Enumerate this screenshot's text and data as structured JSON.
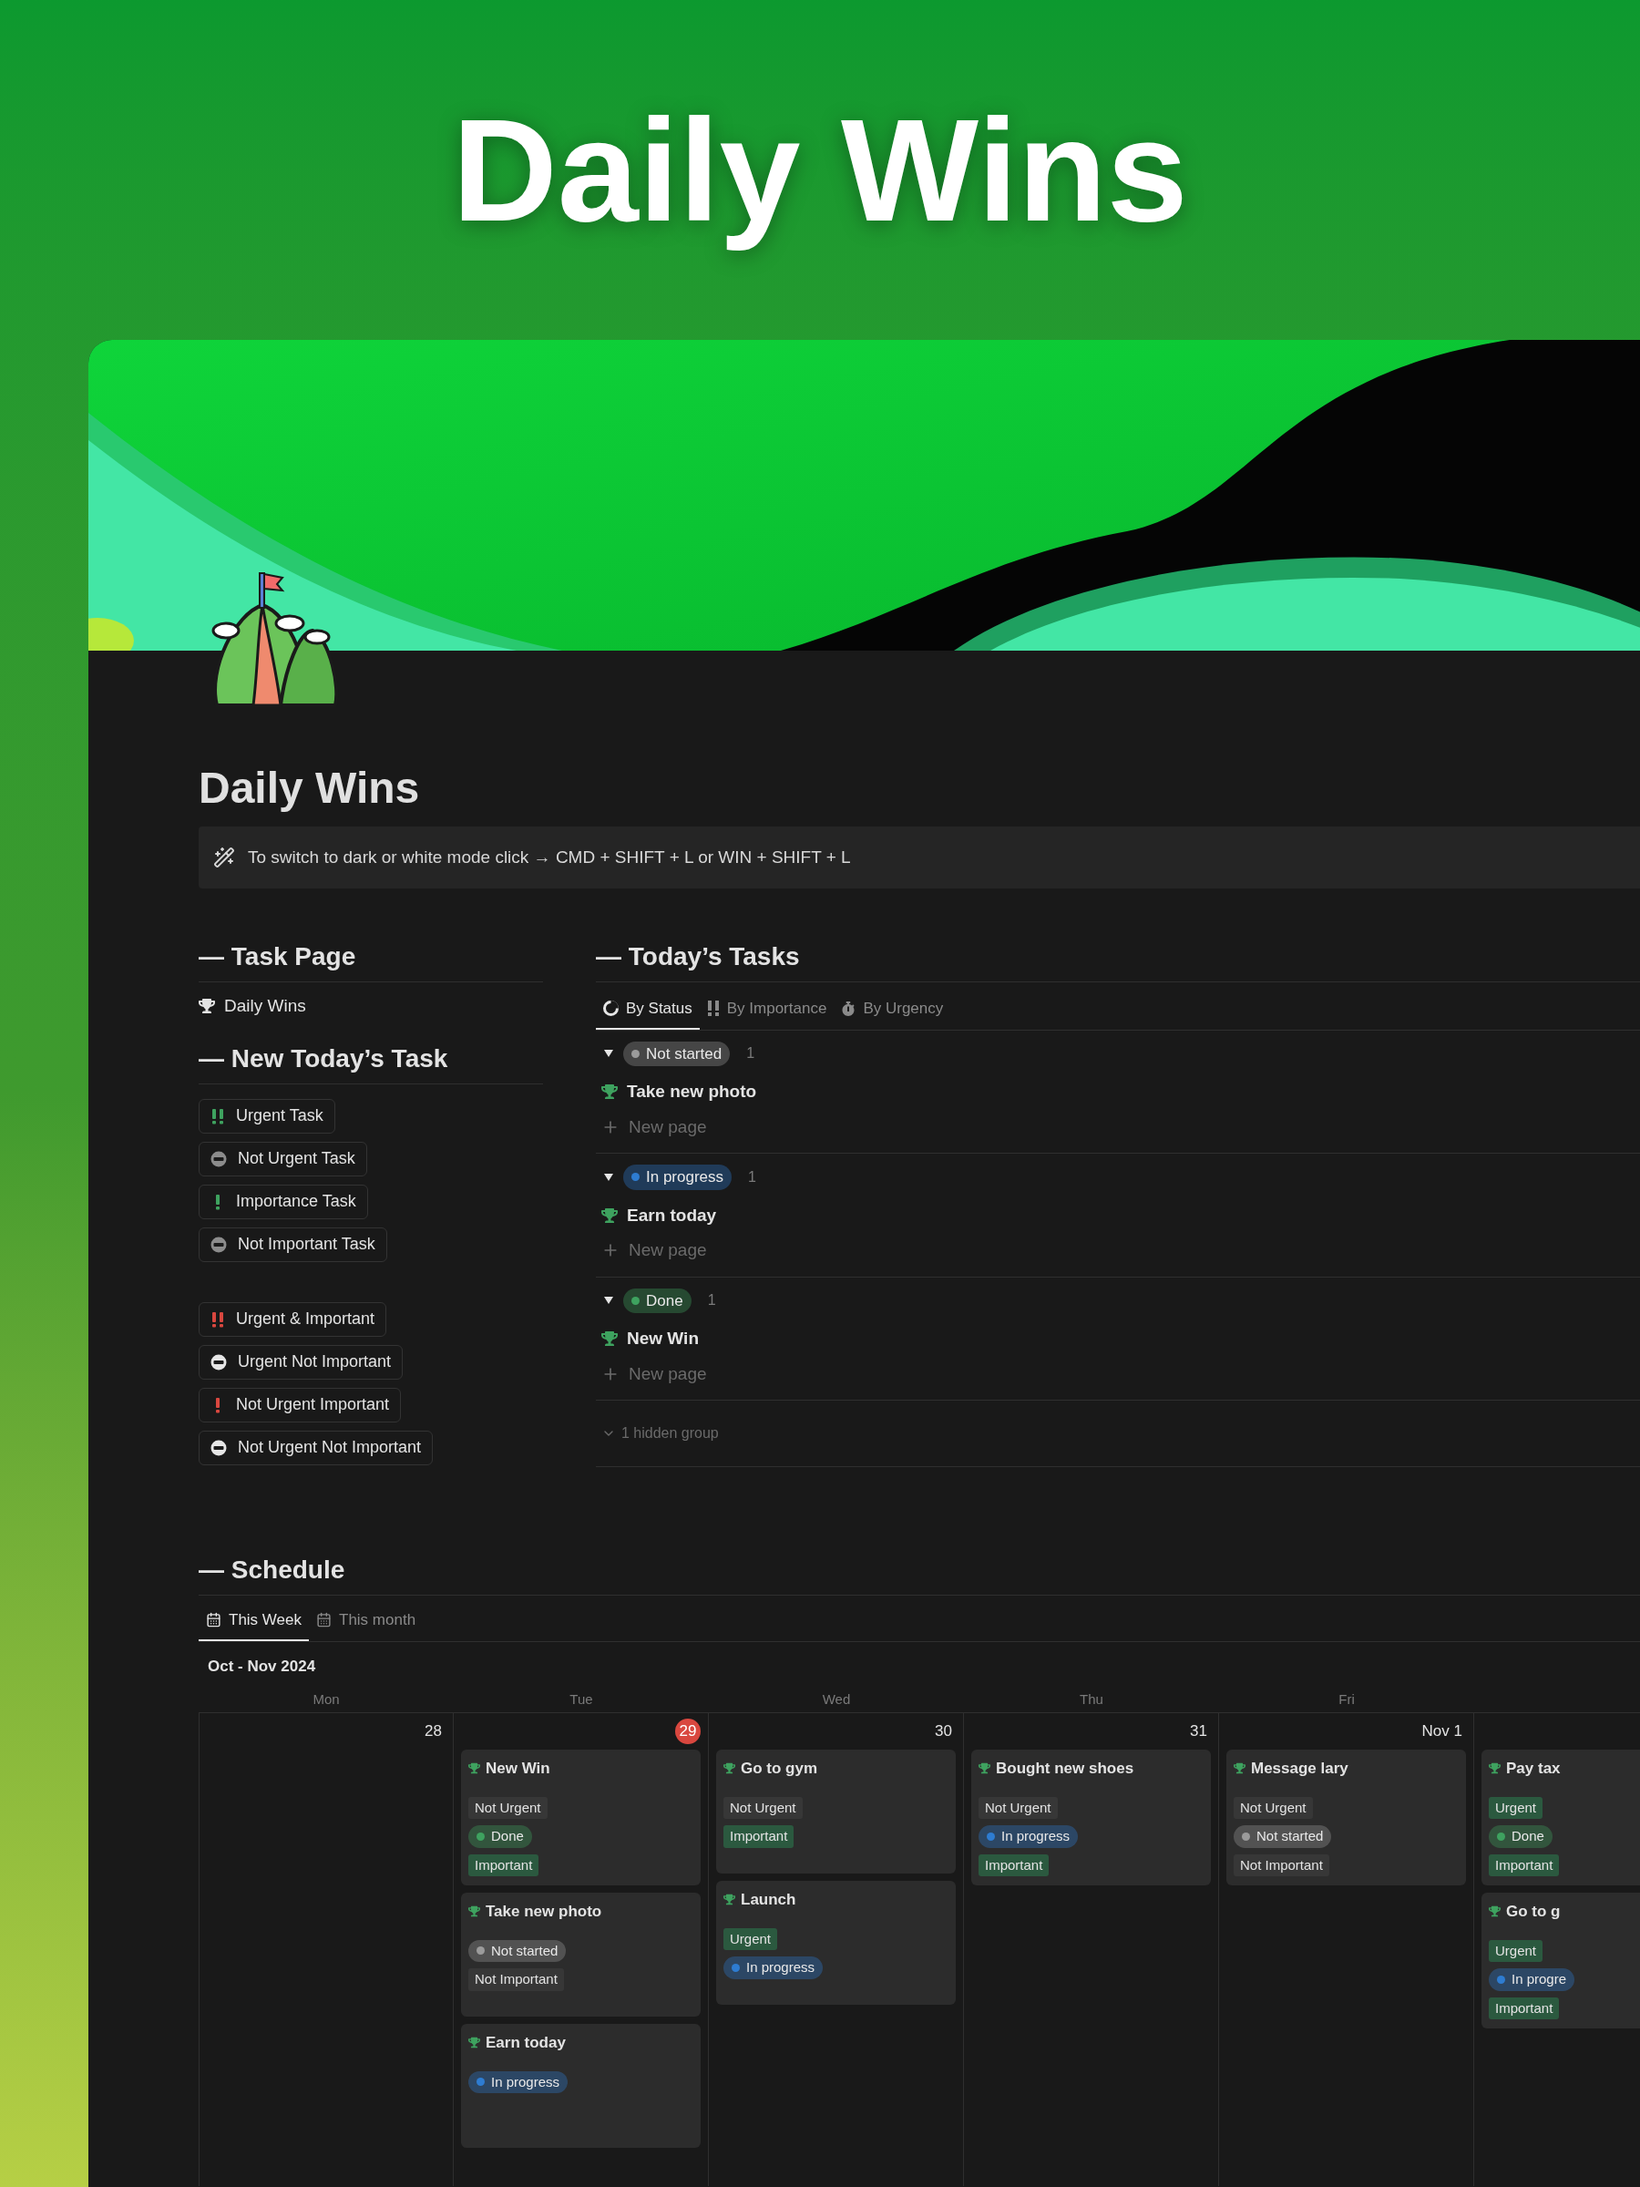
{
  "banner": {
    "title": "Daily Wins"
  },
  "page": {
    "title": "Daily Wins",
    "callout": "To switch to dark or white mode click → CMD + SHIFT + L or WIN + SHIFT + L"
  },
  "task_page": {
    "heading": "— Task Page",
    "links": [
      {
        "label": "Daily Wins"
      }
    ]
  },
  "new_task": {
    "heading": "— New Today’s Task",
    "groups": [
      [
        {
          "label": "Urgent Task",
          "kind": "double",
          "color": "#3ea25f"
        },
        {
          "label": "Not Urgent Task",
          "kind": "minus",
          "color": "#8c8c8c"
        },
        {
          "label": "Importance Task",
          "kind": "single",
          "color": "#3ea25f"
        },
        {
          "label": "Not Important Task",
          "kind": "minus",
          "color": "#8c8c8c"
        }
      ],
      [
        {
          "label": "Urgent & Important",
          "kind": "double",
          "color": "#d9473f"
        },
        {
          "label": "Urgent Not Important",
          "kind": "minus",
          "color": "#e6e6e6"
        },
        {
          "label": "Not Urgent Important",
          "kind": "single",
          "color": "#d9473f"
        },
        {
          "label": "Not Urgent Not Important",
          "kind": "minus",
          "color": "#e6e6e6"
        }
      ]
    ]
  },
  "todays_tasks": {
    "heading": "— Today’s Tasks",
    "tabs": [
      {
        "label": "By Status",
        "selected": true
      },
      {
        "label": "By Importance",
        "selected": false
      },
      {
        "label": "By Urgency",
        "selected": false
      }
    ],
    "groups": [
      {
        "status": {
          "text": "Not started",
          "color": "#9b9b9b"
        },
        "count": "1",
        "expanded": true,
        "items": [
          "Take new photo"
        ],
        "new_page": "New page"
      },
      {
        "status": {
          "text": "In progress",
          "color": "#2e7cd1"
        },
        "count": "1",
        "expanded": true,
        "items": [
          "Earn today"
        ],
        "new_page": "New page"
      },
      {
        "status": {
          "text": "Done",
          "color": "#3ea25f"
        },
        "count": "1",
        "expanded": true,
        "items": [
          "New Win"
        ],
        "new_page": "New page"
      }
    ],
    "hidden_groups": "1 hidden group"
  },
  "schedule": {
    "heading": "— Schedule",
    "tabs": [
      {
        "label": "This Week",
        "selected": true
      },
      {
        "label": "This month",
        "selected": false
      }
    ],
    "range": "Oct - Nov 2024",
    "days": [
      {
        "name": "Mon",
        "date": "28",
        "today": false
      },
      {
        "name": "Tue",
        "date": "29",
        "today": true,
        "cards": [
          {
            "title": "New Win",
            "tags": [
              {
                "kind": "tag",
                "text": "Not Urgent",
                "color": "#373737"
              },
              {
                "kind": "status",
                "text": "Done",
                "color": "#3ea25f"
              },
              {
                "kind": "tag",
                "text": "Important",
                "color": "#2b593f"
              }
            ]
          },
          {
            "title": "Take new photo",
            "tags": [
              {
                "kind": "status",
                "text": "Not started",
                "color": "#9b9b9b"
              },
              {
                "kind": "tag",
                "text": "Not Important",
                "color": "#373737"
              }
            ]
          },
          {
            "title": "Earn today",
            "tags": [
              {
                "kind": "status",
                "text": "In progress",
                "color": "#2e7cd1"
              }
            ]
          }
        ]
      },
      {
        "name": "Wed",
        "date": "30",
        "today": false,
        "cards": [
          {
            "title": "Go to gym",
            "tags": [
              {
                "kind": "tag",
                "text": "Not Urgent",
                "color": "#373737"
              },
              {
                "kind": "tag",
                "text": "Important",
                "color": "#2b593f"
              }
            ]
          },
          {
            "title": "Launch",
            "tags": [
              {
                "kind": "tag",
                "text": "Urgent",
                "color": "#2b593f"
              },
              {
                "kind": "status",
                "text": "In progress",
                "color": "#2e7cd1"
              }
            ]
          }
        ]
      },
      {
        "name": "Thu",
        "date": "31",
        "today": false,
        "cards": [
          {
            "title": "Bought new shoes",
            "tags": [
              {
                "kind": "tag",
                "text": "Not Urgent",
                "color": "#373737"
              },
              {
                "kind": "status",
                "text": "In progress",
                "color": "#2e7cd1"
              },
              {
                "kind": "tag",
                "text": "Important",
                "color": "#2b593f"
              }
            ]
          }
        ]
      },
      {
        "name": "Fri",
        "date": "Nov 1",
        "today": false,
        "cards": [
          {
            "title": "Message lary",
            "tags": [
              {
                "kind": "tag",
                "text": "Not Urgent",
                "color": "#373737"
              },
              {
                "kind": "status",
                "text": "Not started",
                "color": "#9b9b9b"
              },
              {
                "kind": "tag",
                "text": "Not Important",
                "color": "#373737"
              }
            ]
          }
        ]
      },
      {
        "cards": [
          {
            "title": "Pay tax",
            "tags": [
              {
                "kind": "tag",
                "text": "Urgent",
                "color": "#2b593f"
              },
              {
                "kind": "status",
                "text": "Done",
                "color": "#3ea25f"
              },
              {
                "kind": "tag",
                "text": "Important",
                "color": "#2b593f"
              }
            ]
          },
          {
            "title": "Go to g",
            "tags": [
              {
                "kind": "tag",
                "text": "Urgent",
                "color": "#2b593f"
              },
              {
                "kind": "status",
                "text": "In progre",
                "color": "#2e7cd1"
              },
              {
                "kind": "tag",
                "text": "Important",
                "color": "#2b593f"
              }
            ]
          }
        ]
      }
    ]
  }
}
